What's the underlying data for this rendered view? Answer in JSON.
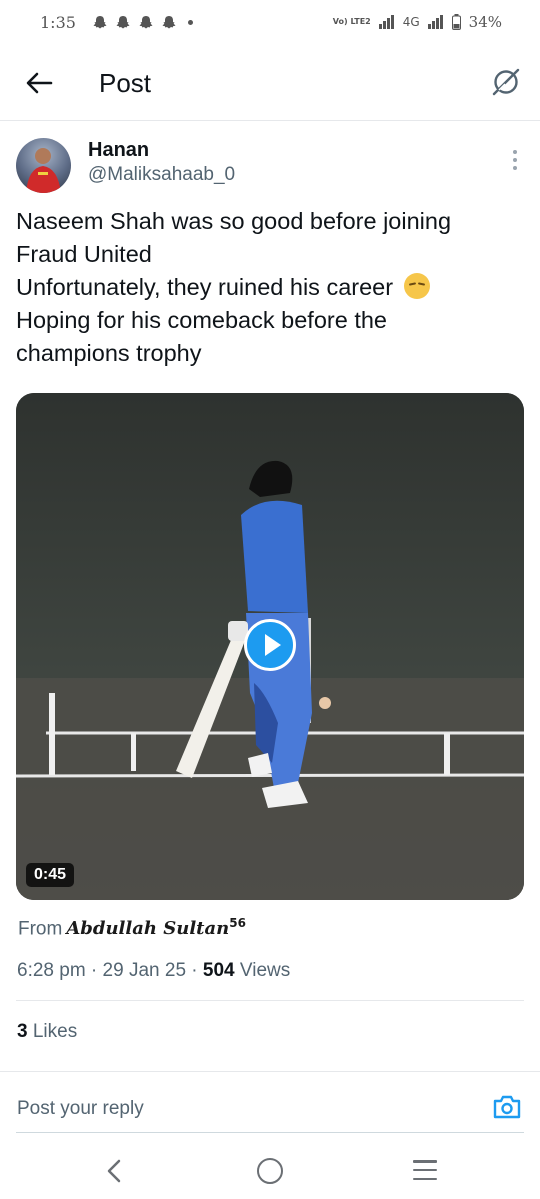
{
  "status_bar": {
    "time": "1:35",
    "network": "4G",
    "carrier_badge": "Vo) LTE2",
    "battery": "34%"
  },
  "header": {
    "title": "Post",
    "back_icon": "arrow-left-icon",
    "grok_icon": "grok-icon"
  },
  "tweet": {
    "author_name": "Hanan",
    "author_handle": "@Maliksahaab_0",
    "text_lines": [
      "Naseem Shah was so good before joining",
      "Fraud United",
      "Unfortunately, they ruined his career",
      "Hoping for his comeback before the",
      "champions trophy"
    ],
    "emoji": "pensive-face-icon",
    "video_duration": "0:45",
    "from_label": "From",
    "from_source": "Abdullah Sultan",
    "from_source_sup": "56",
    "time": "6:28 pm",
    "date": "29 Jan 25",
    "views_count": "504",
    "views_label": "Views",
    "likes_count": "3",
    "likes_label": "Likes"
  },
  "reply": {
    "placeholder": "Post your reply"
  },
  "colors": {
    "accent": "#1d9bf0",
    "text_primary": "#0f1419",
    "text_secondary": "#536471"
  }
}
